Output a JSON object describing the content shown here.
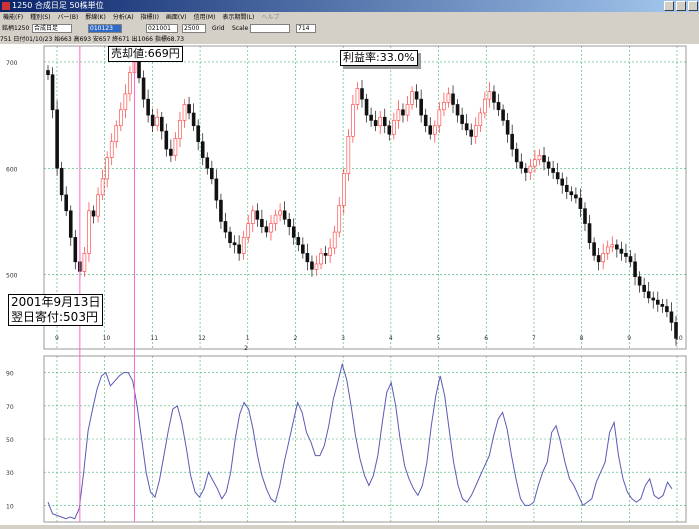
{
  "window": {
    "title": "1250  合成日足  50株単位"
  },
  "menu": [
    "機能(F)",
    "種別(S)",
    "バー(B)",
    "罫線(K)",
    "分析(A)",
    "指標(I)",
    "画面(V)",
    "信用(M)",
    "表示期間(L)",
    "ヘルプ"
  ],
  "toolbar": {
    "code_label": "銘柄1250",
    "mode_value": "合成日足",
    "date_from": "010123",
    "date_to": "021001",
    "range_value": "2500",
    "grid_label": "Grid",
    "scale_label": "Scale",
    "price_value": "714"
  },
  "infobar": "751 日付01/10/23 始663 高693 安657 終671 出1066 指標68.73",
  "annotations": {
    "sell_price": "売却値:669円",
    "profit_rate": "利益率:33.0%",
    "buy_date": "2001年9月13日",
    "buy_price": "翌日寄付:503円"
  },
  "chart_data": [
    {
      "type": "candlestick",
      "y_ticks": [
        "700",
        "600",
        "500"
      ],
      "x_ticks": [
        "9",
        "10",
        "11",
        "12",
        "1",
        "2",
        "3",
        "4",
        "5",
        "6",
        "7",
        "8",
        "9",
        "10"
      ],
      "x_sublabel": "2",
      "ylim": [
        430,
        715
      ],
      "colors": {
        "up": "#ff3b3b",
        "down": "#111111",
        "grid": "#3cb371",
        "marker": "#ff66cc"
      },
      "close": [
        688,
        655,
        600,
        575,
        560,
        535,
        512,
        503,
        520,
        560,
        555,
        575,
        590,
        610,
        625,
        640,
        655,
        670,
        690,
        700,
        685,
        665,
        650,
        640,
        648,
        635,
        618,
        612,
        628,
        645,
        660,
        652,
        640,
        625,
        610,
        600,
        590,
        570,
        550,
        540,
        530,
        528,
        520,
        535,
        548,
        560,
        552,
        545,
        540,
        548,
        556,
        560,
        552,
        545,
        535,
        528,
        520,
        512,
        505,
        510,
        520,
        518,
        525,
        540,
        565,
        595,
        630,
        660,
        675,
        665,
        650,
        645,
        640,
        648,
        640,
        632,
        645,
        655,
        650,
        660,
        672,
        665,
        650,
        640,
        632,
        640,
        655,
        662,
        670,
        660,
        650,
        642,
        636,
        630,
        640,
        652,
        665,
        672,
        662,
        655,
        645,
        632,
        618,
        606,
        600,
        596,
        602,
        608,
        612,
        606,
        600,
        596,
        590,
        584,
        578,
        575,
        572,
        562,
        548,
        530,
        518,
        512,
        520,
        526,
        528,
        524,
        520,
        517,
        512,
        498,
        490,
        484,
        478,
        476,
        472,
        470,
        465,
        455,
        440
      ],
      "buy_marker_index": 7,
      "sell_marker_index": 19
    },
    {
      "type": "line",
      "y_ticks": [
        "90",
        "70",
        "50",
        "30",
        "10"
      ],
      "ylim": [
        0,
        100
      ],
      "color": "#5a5ab4",
      "values": [
        12,
        5,
        4,
        3,
        2,
        3,
        2,
        8,
        30,
        55,
        68,
        80,
        88,
        90,
        82,
        85,
        88,
        90,
        90,
        85,
        70,
        50,
        30,
        18,
        15,
        25,
        40,
        55,
        68,
        70,
        60,
        45,
        28,
        18,
        15,
        20,
        30,
        25,
        20,
        14,
        18,
        30,
        50,
        65,
        72,
        68,
        56,
        40,
        28,
        20,
        14,
        12,
        22,
        36,
        48,
        60,
        72,
        66,
        54,
        48,
        40,
        40,
        46,
        58,
        74,
        84,
        95,
        86,
        70,
        52,
        38,
        28,
        22,
        28,
        40,
        60,
        78,
        84,
        70,
        50,
        34,
        26,
        20,
        16,
        22,
        36,
        58,
        76,
        88,
        76,
        56,
        36,
        22,
        14,
        12,
        16,
        22,
        28,
        34,
        40,
        52,
        62,
        66,
        56,
        40,
        26,
        14,
        10,
        10,
        12,
        22,
        30,
        36,
        54,
        58,
        48,
        36,
        26,
        22,
        16,
        10,
        12,
        14,
        24,
        30,
        36,
        54,
        60,
        40,
        26,
        18,
        14,
        12,
        14,
        22,
        26,
        16,
        14,
        16,
        24,
        20
      ]
    }
  ]
}
